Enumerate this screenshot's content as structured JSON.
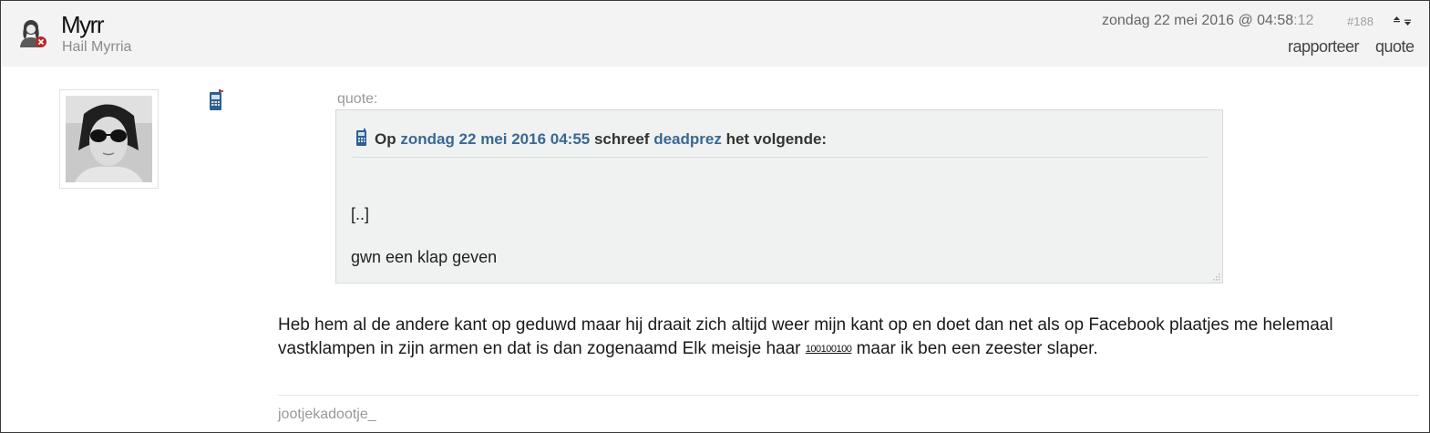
{
  "post": {
    "username": "Myrr",
    "user_title": "Hail Myrria",
    "date_main": "zondag 22 mei 2016 @ 04:58",
    "date_seconds": ":12",
    "post_number": "#188",
    "actions": {
      "report": "rapporteer",
      "quote": "quote"
    }
  },
  "quote": {
    "label": "quote:",
    "intro_op": "Op",
    "date_link": "zondag 22 mei 2016 04:55",
    "intro_wrote": "schreef",
    "author_link": "deadprez",
    "intro_end": "het volgende:",
    "line1": "[..]",
    "line2": "gwn een klap geven"
  },
  "body": {
    "text_before": "Heb hem al de andere kant op geduwd maar hij draait zich altijd weer mijn kant op en doet dan net als op Facebook plaatjes me helemaal vastklampen in zijn armen en dat is dan zogenaamd Elk meisje haar ",
    "inline_link": "100100100",
    "text_after": " maar ik ben een zeester slaper."
  },
  "signature": "jootjekadootje_",
  "icons": {
    "user": "user-female-icon",
    "arrows": "sort-arrows-icon",
    "phone": "phone-icon",
    "quote_phone": "phone-icon",
    "grip": "resize-grip-icon"
  },
  "colors": {
    "link": "#3a6893",
    "header_bg": "#f3f3f3",
    "quote_bg": "#f0f1f1"
  }
}
